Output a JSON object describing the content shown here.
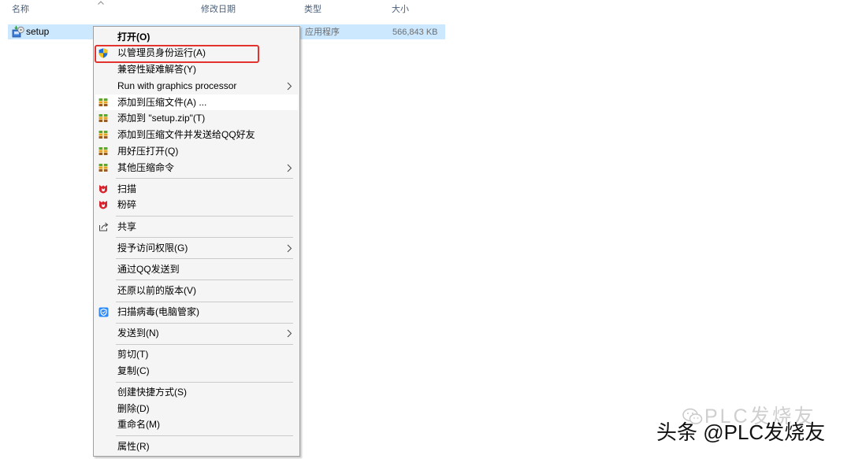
{
  "colors": {
    "selected_row": "#cce8ff",
    "annotation_box": "#e2332e",
    "menu_background": "#f5f5f5",
    "header_text": "#4c607a"
  },
  "header": {
    "name": "名称",
    "modified": "修改日期",
    "type": "类型",
    "size": "大小",
    "sort_icon": "chevron-up-icon"
  },
  "file": {
    "name": "setup",
    "icon": "installer-icon",
    "type": "应用程序",
    "size": "566,843 KB"
  },
  "context_menu": {
    "submenu_icon": "chevron-right-icon",
    "groups": [
      {
        "items": [
          {
            "label": "打开(O)",
            "bold": true
          },
          {
            "label": "以管理员身份运行(A)",
            "icon": "uac-shield-icon"
          },
          {
            "label": "兼容性疑难解答(Y)"
          },
          {
            "label": "Run with graphics processor",
            "submenu": true
          },
          {
            "label": "添加到压缩文件(A) ...",
            "icon": "archive-icon",
            "hovered": true
          },
          {
            "label": "添加到 \"setup.zip\"(T)",
            "icon": "archive-icon"
          },
          {
            "label": "添加到压缩文件并发送给QQ好友",
            "icon": "archive-icon"
          },
          {
            "label": "用好压打开(Q)",
            "icon": "archive-icon"
          },
          {
            "label": "其他压缩命令",
            "icon": "archive-icon",
            "submenu": true
          }
        ]
      },
      {
        "items": [
          {
            "label": "扫描",
            "icon": "antivirus-icon"
          },
          {
            "label": "粉碎",
            "icon": "antivirus-icon"
          }
        ]
      },
      {
        "items": [
          {
            "label": "共享",
            "icon": "share-icon"
          }
        ]
      },
      {
        "items": [
          {
            "label": "授予访问权限(G)",
            "submenu": true
          }
        ]
      },
      {
        "items": [
          {
            "label": "通过QQ发送到"
          }
        ]
      },
      {
        "items": [
          {
            "label": "还原以前的版本(V)"
          }
        ]
      },
      {
        "items": [
          {
            "label": "扫描病毒(电脑管家)",
            "icon": "pc-manager-shield-icon"
          }
        ]
      },
      {
        "items": [
          {
            "label": "发送到(N)",
            "submenu": true
          }
        ]
      },
      {
        "items": [
          {
            "label": "剪切(T)"
          },
          {
            "label": "复制(C)"
          }
        ]
      },
      {
        "items": [
          {
            "label": "创建快捷方式(S)"
          },
          {
            "label": "删除(D)"
          },
          {
            "label": "重命名(M)"
          }
        ]
      },
      {
        "items": [
          {
            "label": "属性(R)"
          }
        ]
      }
    ]
  },
  "watermark": {
    "faded_icon": "wechat-logo-icon",
    "faded_text": "PLC发烧友",
    "text": "头条 @PLC发烧友"
  }
}
